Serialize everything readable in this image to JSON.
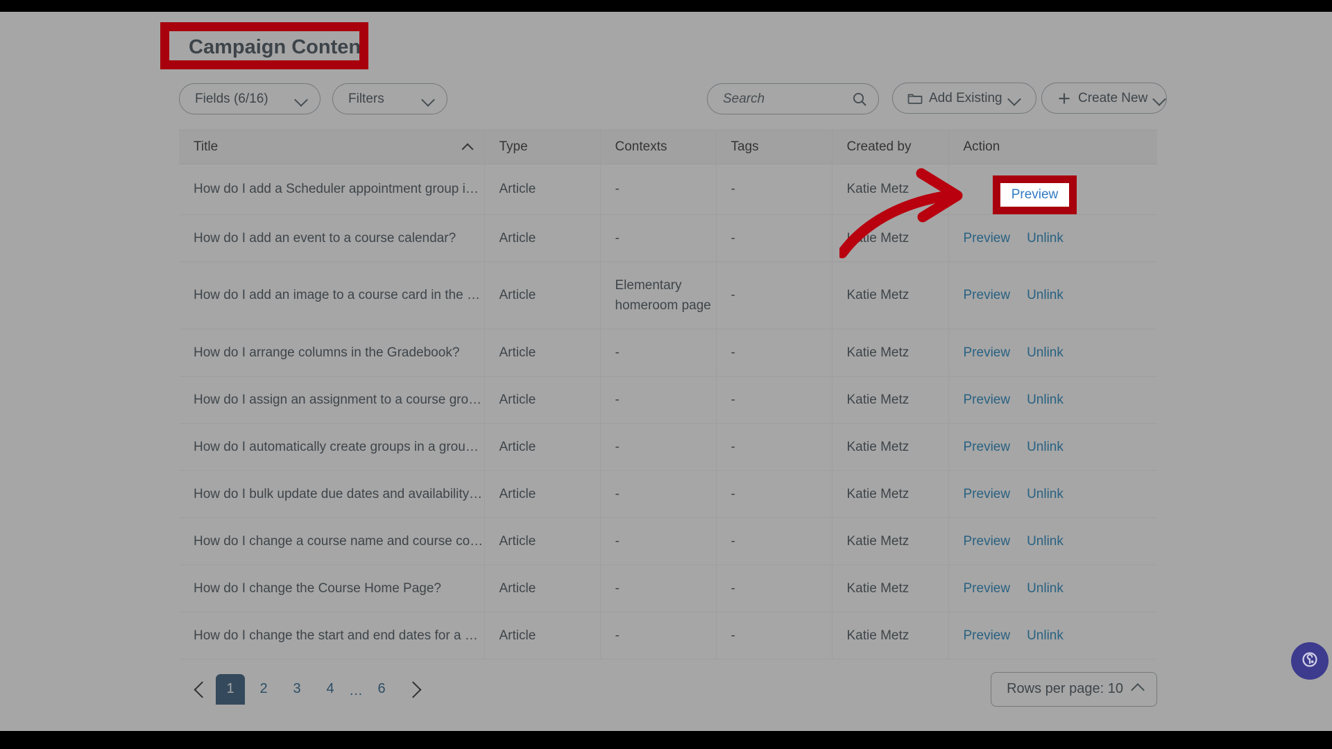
{
  "page_title": "Campaign Content",
  "toolbar": {
    "fields_label": "Fields (6/16)",
    "filters_label": "Filters",
    "search_placeholder": "Search",
    "search_value": "",
    "add_existing_label": "Add Existing",
    "create_new_label": "Create New"
  },
  "table": {
    "columns": [
      {
        "key": "title",
        "label": "Title",
        "sorted": "asc"
      },
      {
        "key": "type",
        "label": "Type"
      },
      {
        "key": "contexts",
        "label": "Contexts"
      },
      {
        "key": "tags",
        "label": "Tags"
      },
      {
        "key": "created_by",
        "label": "Created by"
      },
      {
        "key": "action",
        "label": "Action"
      }
    ],
    "action_labels": {
      "preview": "Preview",
      "unlink": "Unlink"
    },
    "rows": [
      {
        "title": "How do I add a Scheduler appointment group in …",
        "type": "Article",
        "contexts": "-",
        "tags": "-",
        "created_by": "Katie Metz",
        "highlighted": true
      },
      {
        "title": "How do I add an event to a course calendar?",
        "type": "Article",
        "contexts": "-",
        "tags": "-",
        "created_by": "Katie Metz",
        "highlighted": false
      },
      {
        "title": "How do I add an image to a course card in the D…",
        "type": "Article",
        "contexts": "Elementary homeroom page",
        "tags": "-",
        "created_by": "Katie Metz",
        "highlighted": false
      },
      {
        "title": "How do I arrange columns in the Gradebook?",
        "type": "Article",
        "contexts": "-",
        "tags": "-",
        "created_by": "Katie Metz",
        "highlighted": false
      },
      {
        "title": "How do I assign an assignment to a course grou…",
        "type": "Article",
        "contexts": "-",
        "tags": "-",
        "created_by": "Katie Metz",
        "highlighted": false
      },
      {
        "title": "How do I automatically create groups in a group …",
        "type": "Article",
        "contexts": "-",
        "tags": "-",
        "created_by": "Katie Metz",
        "highlighted": false
      },
      {
        "title": "How do I bulk update due dates and availability …",
        "type": "Article",
        "contexts": "-",
        "tags": "-",
        "created_by": "Katie Metz",
        "highlighted": false
      },
      {
        "title": "How do I change a course name and course co…",
        "type": "Article",
        "contexts": "-",
        "tags": "-",
        "created_by": "Katie Metz",
        "highlighted": false
      },
      {
        "title": "How do I change the Course Home Page?",
        "type": "Article",
        "contexts": "-",
        "tags": "-",
        "created_by": "Katie Metz",
        "highlighted": false
      },
      {
        "title": "How do I change the start and end dates for a c…",
        "type": "Article",
        "contexts": "-",
        "tags": "-",
        "created_by": "Katie Metz",
        "highlighted": false
      }
    ]
  },
  "footer": {
    "prev_label": "Previous page",
    "next_label": "Next page",
    "pages": [
      "1",
      "2",
      "3",
      "4",
      "…",
      "6"
    ],
    "active_page": "1",
    "rows_per_page_label": "Rows per page: 10"
  },
  "annotations": {
    "title_box_color": "#a8000c",
    "preview_box_color": "#a8000c",
    "arrow_color": "#b8000f",
    "highlighted_action_label": "Preview"
  },
  "help_widget": {
    "icon": "headset-help-icon"
  },
  "colors": {
    "link": "#0374b5",
    "text": "#2d3b45",
    "header_bg": "#f5f5f5",
    "pagination_active": "#1b4469",
    "help_widget": "#3d3b8e",
    "annotation_red": "#a8000c"
  }
}
